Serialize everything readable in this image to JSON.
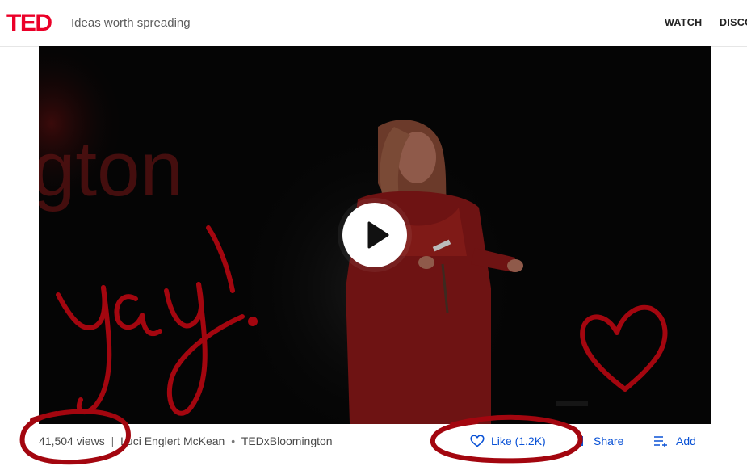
{
  "header": {
    "logo": "TED",
    "tagline": "Ideas worth spreading",
    "nav": [
      "WATCH",
      "DISCO"
    ]
  },
  "video": {
    "backdrop_text": "gton",
    "play_icon": "play-icon"
  },
  "talk": {
    "views": "41,504 views",
    "speaker": "Luci Englert McKean",
    "event": "TEDxBloomington",
    "separator_pipe": "|",
    "separator_dot": "•"
  },
  "actions": {
    "like_label": "Like (1.2K)",
    "share_label": "Share",
    "add_label": "Add"
  },
  "annotation": {
    "handwriting": "yay!",
    "ink_color": "#a3060f"
  },
  "colors": {
    "ted_red": "#eb0028",
    "link_blue": "#0a52d6"
  }
}
